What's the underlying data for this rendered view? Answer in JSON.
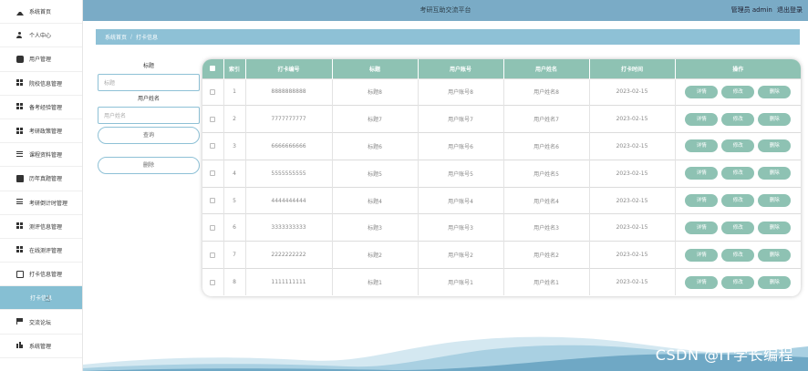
{
  "header": {
    "title": "考研互助交流平台",
    "user_label": "管理员 admin",
    "logout_label": "退出登录"
  },
  "sidebar": {
    "items": [
      {
        "label": "系统首页",
        "icon": "home-icon"
      },
      {
        "label": "个人中心",
        "icon": "person-icon"
      },
      {
        "label": "用户管理",
        "icon": "users-icon"
      },
      {
        "label": "院校信息管理",
        "icon": "grid-icon"
      },
      {
        "label": "备考经验管理",
        "icon": "grid-icon"
      },
      {
        "label": "考研政策管理",
        "icon": "grid-icon"
      },
      {
        "label": "课程资料管理",
        "icon": "list-icon"
      },
      {
        "label": "历年真题管理",
        "icon": "book-icon"
      },
      {
        "label": "考研倒计时管理",
        "icon": "list-icon"
      },
      {
        "label": "测评信息管理",
        "icon": "grid-icon"
      },
      {
        "label": "在线测评管理",
        "icon": "grid-icon"
      },
      {
        "label": "打卡信息管理",
        "icon": "clipboard-icon"
      },
      {
        "label": "打卡信息",
        "icon": "",
        "active": true
      },
      {
        "label": "交流论坛",
        "icon": "flag-icon"
      },
      {
        "label": "系统管理",
        "icon": "bars-icon"
      }
    ]
  },
  "breadcrumb": {
    "home": "系统首页",
    "separator": "/",
    "current": "打卡信息"
  },
  "search": {
    "title_label": "标题",
    "title_placeholder": "标题",
    "name_label": "用户姓名",
    "name_placeholder": "用户姓名",
    "query_button": "查询",
    "delete_button": "删除"
  },
  "table": {
    "columns": [
      "",
      "索引",
      "打卡编号",
      "标题",
      "用户账号",
      "用户姓名",
      "打卡时间",
      "操作"
    ],
    "actions": [
      "详情",
      "修改",
      "删除"
    ],
    "rows": [
      {
        "index": "1",
        "code": "8888888888",
        "title": "标题8",
        "account": "用户账号8",
        "name": "用户姓名8",
        "time": "2023-02-15"
      },
      {
        "index": "2",
        "code": "7777777777",
        "title": "标题7",
        "account": "用户账号7",
        "name": "用户姓名7",
        "time": "2023-02-15"
      },
      {
        "index": "3",
        "code": "6666666666",
        "title": "标题6",
        "account": "用户账号6",
        "name": "用户姓名6",
        "time": "2023-02-15"
      },
      {
        "index": "4",
        "code": "5555555555",
        "title": "标题5",
        "account": "用户账号5",
        "name": "用户姓名5",
        "time": "2023-02-15"
      },
      {
        "index": "5",
        "code": "4444444444",
        "title": "标题4",
        "account": "用户账号4",
        "name": "用户姓名4",
        "time": "2023-02-15"
      },
      {
        "index": "6",
        "code": "3333333333",
        "title": "标题3",
        "account": "用户账号3",
        "name": "用户姓名3",
        "time": "2023-02-15"
      },
      {
        "index": "7",
        "code": "2222222222",
        "title": "标题2",
        "account": "用户账号2",
        "name": "用户姓名2",
        "time": "2023-02-15"
      },
      {
        "index": "8",
        "code": "1111111111",
        "title": "标题1",
        "account": "用户账号1",
        "name": "用户姓名1",
        "time": "2023-02-15"
      }
    ]
  },
  "watermark": "CSDN @IT学长编程",
  "colors": {
    "header": "#7aabc6",
    "breadcrumb": "#8ec1d6",
    "table_header": "#8ec2b3",
    "action_button": "#8ec2b3",
    "active_sidebar": "#86bfd3"
  }
}
